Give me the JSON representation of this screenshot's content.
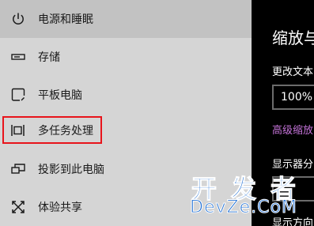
{
  "sidebar": {
    "items": [
      {
        "label": "电源和睡眠",
        "icon": "power-icon",
        "selected": true
      },
      {
        "label": "存储",
        "icon": "storage-icon",
        "selected": false
      },
      {
        "label": "平板电脑",
        "icon": "tablet-mode-icon",
        "selected": false
      },
      {
        "label": "多任务处理",
        "icon": "multitasking-icon",
        "selected": false,
        "highlighted": true
      },
      {
        "label": "投影到此电脑",
        "icon": "project-to-pc-icon",
        "selected": false
      },
      {
        "label": "体验共享",
        "icon": "shared-experiences-icon",
        "selected": false
      }
    ]
  },
  "content": {
    "section_title": "缩放与",
    "change_text_label": "更改文本",
    "scale_value": "100%",
    "advanced_link": "高级缩放",
    "resolution_label": "显示器分",
    "orientation_label": "显示方向"
  },
  "watermark": {
    "line1": "开发者",
    "line2": "DevZe.CoM"
  },
  "colors": {
    "sidebar_bg": "#d5d5d5",
    "selected_bg": "#c2c2c2",
    "highlight_border": "#e8141b",
    "content_bg": "#000000",
    "link_color": "#c473d8",
    "watermark_color": "#1f6fd4"
  }
}
